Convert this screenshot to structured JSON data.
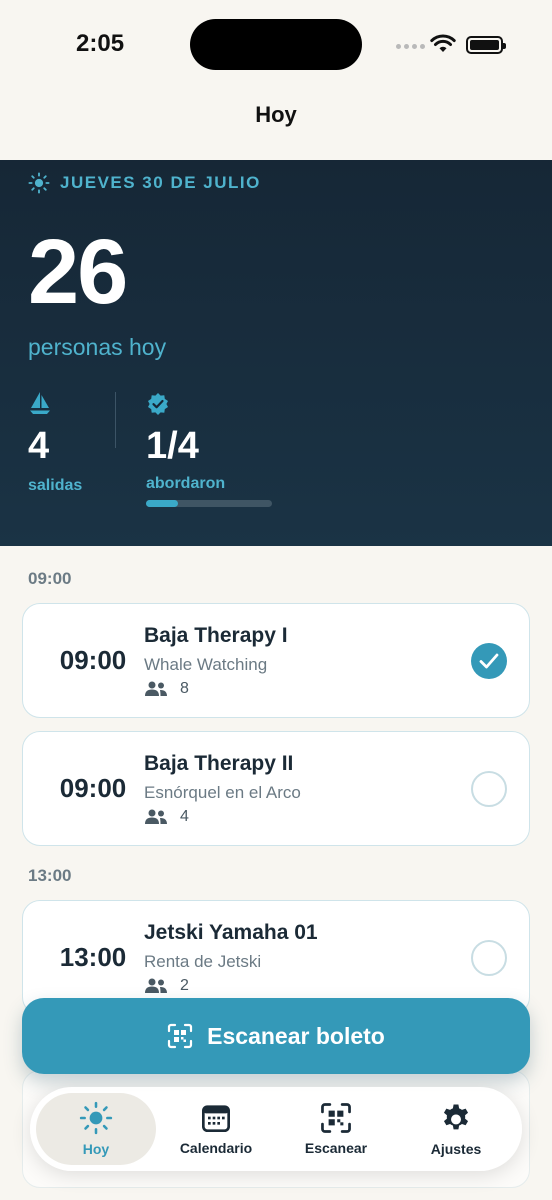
{
  "status_bar": {
    "time": "2:05"
  },
  "nav": {
    "title": "Hoy"
  },
  "hero": {
    "date": "JUEVES 30 DE JULIO",
    "people_count": "26",
    "people_label": "personas hoy",
    "departures_value": "4",
    "departures_label": "salidas",
    "boarded_value": "1/4",
    "boarded_label": "abordaron",
    "boarded_progress": 0.25
  },
  "sections": [
    {
      "header": "09:00",
      "items": [
        {
          "time": "09:00",
          "title": "Baja Therapy I",
          "subtitle": "Whale Watching",
          "count": "8",
          "boarded": true
        },
        {
          "time": "09:00",
          "title": "Baja Therapy II",
          "subtitle": "Esnórquel en el Arco",
          "count": "4",
          "boarded": false
        }
      ]
    },
    {
      "header": "13:00",
      "items": [
        {
          "time": "13:00",
          "title": "Jetski Yamaha 01",
          "subtitle": "Renta de Jetski",
          "count": "2",
          "boarded": false
        }
      ]
    }
  ],
  "scan_button": {
    "label": "Escanear boleto"
  },
  "tabs": [
    {
      "label": "Hoy",
      "icon": "sun-icon",
      "active": true
    },
    {
      "label": "Calendario",
      "icon": "calendar-icon",
      "active": false
    },
    {
      "label": "Escanear",
      "icon": "qr-scan-icon",
      "active": false
    },
    {
      "label": "Ajustes",
      "icon": "gear-icon",
      "active": false
    }
  ],
  "colors": {
    "accent": "#3499b8",
    "hero_bg": "#162736",
    "hero_text_accent": "#4fb3cd"
  }
}
